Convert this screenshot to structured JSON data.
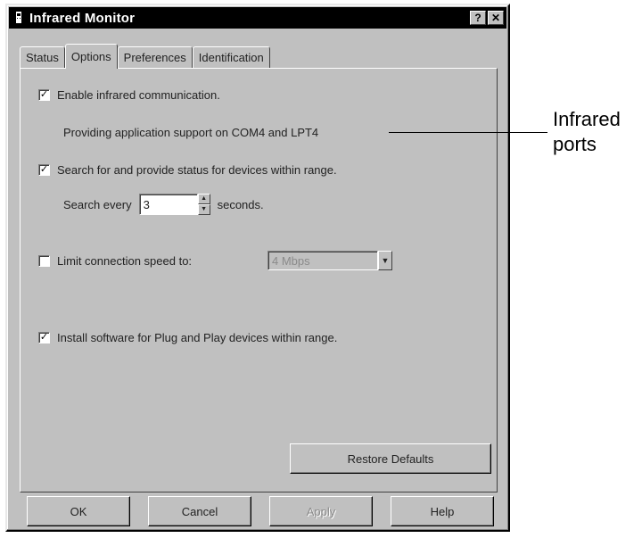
{
  "window": {
    "title": "Infrared Monitor",
    "help_button": "?",
    "close_button": "✕"
  },
  "tabs": [
    {
      "label": "Status",
      "active": false
    },
    {
      "label": "Options",
      "active": true
    },
    {
      "label": "Preferences",
      "active": false
    },
    {
      "label": "Identification",
      "active": false
    }
  ],
  "options": {
    "enable_ir": {
      "label": "Enable infrared communication.",
      "checked": true
    },
    "support_text": "Providing application support on COM4 and LPT4",
    "search": {
      "label": "Search for and provide status for devices within range.",
      "checked": true
    },
    "search_every_label": "Search every",
    "search_every_value": "3",
    "seconds_label": "seconds.",
    "limit_speed": {
      "label": "Limit connection speed to:",
      "checked": false
    },
    "speed_value": "4 Mbps",
    "install_software": {
      "label": "Install software for Plug and Play devices within range.",
      "checked": true
    },
    "restore_defaults": "Restore Defaults"
  },
  "buttons": {
    "ok": "OK",
    "cancel": "Cancel",
    "apply": "Apply",
    "help": "Help"
  },
  "annotation": {
    "line1": "Infrared",
    "line2": "ports"
  }
}
